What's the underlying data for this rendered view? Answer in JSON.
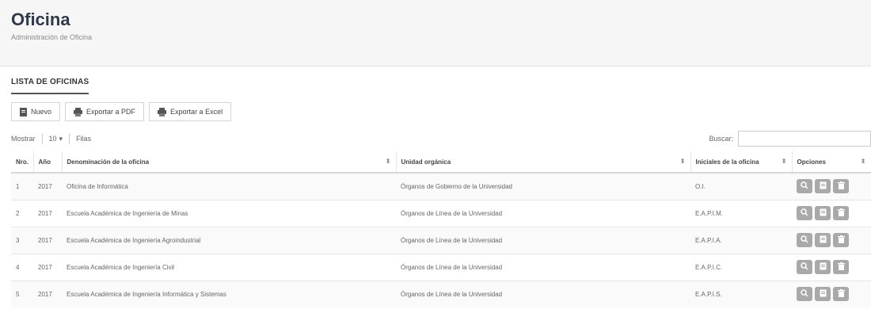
{
  "header": {
    "title": "Oficina",
    "subtitle": "Administración de Oficina"
  },
  "panel": {
    "title": "LISTA DE OFICINAS"
  },
  "toolbar": {
    "new_label": "Nuevo",
    "pdf_label": "Exportar a PDF",
    "excel_label": "Exportar a Excel"
  },
  "controls": {
    "show_label": "Mostrar",
    "page_length": "10",
    "records_label": "Filas",
    "search_label": "Buscar:"
  },
  "table": {
    "headers": [
      "Nro.",
      "Año",
      "Denominación de la oficina",
      "Unidad orgánica",
      "Iniciales de la oficina",
      "Opciones"
    ],
    "rows": [
      {
        "nro": "1",
        "anio": "2017",
        "denominacion": "Oficina de Informática",
        "unidad": "Órganos de Gobierno de la Universidad",
        "iniciales": "O.I."
      },
      {
        "nro": "2",
        "anio": "2017",
        "denominacion": "Escuela Académica de Ingeniería de Minas",
        "unidad": "Órganos de Línea de la Universidad",
        "iniciales": "E.A.P.I.M."
      },
      {
        "nro": "3",
        "anio": "2017",
        "denominacion": "Escuela Académica de Ingeniería Agroindustrial",
        "unidad": "Órganos de Línea de la Universidad",
        "iniciales": "E.A.P.I.A."
      },
      {
        "nro": "4",
        "anio": "2017",
        "denominacion": "Escuela Académica de Ingeniería Civil",
        "unidad": "Órganos de Línea de la Universidad",
        "iniciales": "E.A.P.I.C."
      },
      {
        "nro": "5",
        "anio": "2017",
        "denominacion": "Escuela Académica de Ingeniería Informática y Sistemas",
        "unidad": "Órganos de Línea de la Universidad",
        "iniciales": "E.A.P.I.S."
      }
    ]
  },
  "icons": {
    "new": "file-icon",
    "pdf": "printer-icon",
    "excel": "printer-icon",
    "view": "search-icon",
    "edit": "edit-icon",
    "delete": "trash-icon"
  }
}
